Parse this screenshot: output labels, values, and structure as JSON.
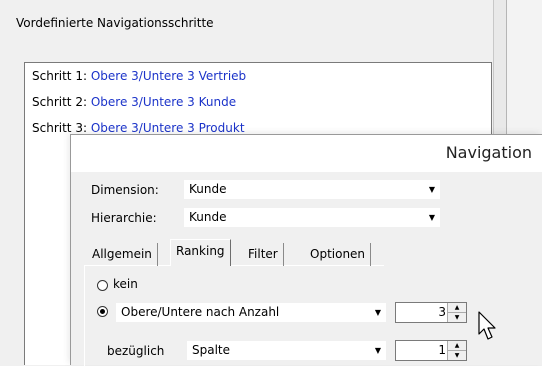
{
  "background": {
    "predefined_label": "Vordefinierte Navigationsschritte",
    "steps": [
      {
        "label": "Schritt 1:",
        "value": "Obere 3/Untere 3 Vertrieb"
      },
      {
        "label": "Schritt 2:",
        "value": "Obere 3/Untere 3 Kunde"
      },
      {
        "label": "Schritt 3:",
        "value": "Obere 3/Untere 3 Produkt"
      }
    ]
  },
  "dialog": {
    "title": "Navigation",
    "dimension": {
      "label": "Dimension:",
      "value": "Kunde"
    },
    "hierarchy": {
      "label": "Hierarchie:",
      "value": "Kunde"
    },
    "tabs": [
      {
        "label": "Allgemein",
        "active": false
      },
      {
        "label": "Ranking",
        "active": true
      },
      {
        "label": "Filter",
        "active": false
      },
      {
        "label": "Optionen",
        "active": false
      }
    ],
    "ranking": {
      "option_none": "kein",
      "option_top_bottom": "Obere/Untere nach Anzahl",
      "count": "3",
      "relative_label": "bezüglich",
      "relative_value": "Spalte",
      "relative_count": "1"
    }
  },
  "colors": {
    "link_blue": "#1b33c9"
  }
}
